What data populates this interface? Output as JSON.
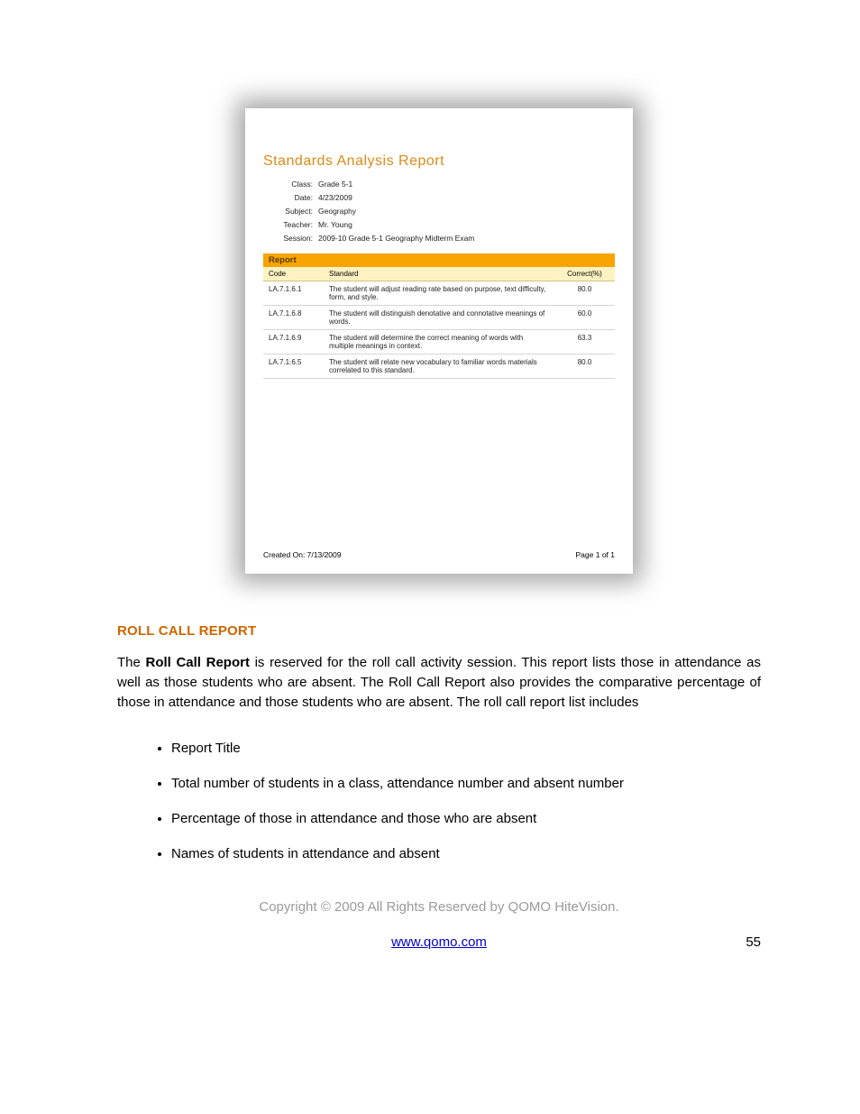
{
  "screenshot": {
    "title": "Standards  Analysis  Report",
    "meta": {
      "class_label": "Class:",
      "class_value": "Grade 5-1",
      "date_label": "Date:",
      "date_value": "4/23/2009",
      "subject_label": "Subject:",
      "subject_value": "Geography",
      "teacher_label": "Teacher:",
      "teacher_value": "Mr. Young",
      "session_label": "Session:",
      "session_value": "2009-10 Grade 5-1 Geography Midterm Exam"
    },
    "report_header": "Report",
    "columns": {
      "code": "Code",
      "standard": "Standard",
      "correct": "Correct(%)"
    },
    "rows": [
      {
        "code": "LA.7.1.6.1",
        "standard": "The student will adjust reading rate based on purpose, text difficulty, form, and style.",
        "pct": "80.0"
      },
      {
        "code": "LA.7.1.6.8",
        "standard": "The student will distinguish denotative and connotative meanings of words.",
        "pct": "60.0"
      },
      {
        "code": "LA.7.1.6.9",
        "standard": "The student will determine the correct meaning of words with multiple meanings in context.",
        "pct": "63.3"
      },
      {
        "code": "LA.7.1.6.5",
        "standard": "The student will relate new vocabulary to familiar words materials correlated to this standard.",
        "pct": "80.0"
      }
    ],
    "footer": {
      "created": "Created On: 7/13/2009",
      "page": "Page 1 of 1"
    }
  },
  "section_heading": "ROLL CALL REPORT",
  "body_intro_prefix": "The ",
  "body_intro_bold": "Roll Call Report",
  "body_intro_rest": " is reserved for the roll call activity session. This report lists those in attendance as well as those students who are absent. The Roll Call Report also provides the comparative percentage of those in attendance and those students who are absent. The roll call report list includes",
  "bullets": [
    "Report Title",
    "Total number of students in a class, attendance number and absent number",
    "Percentage of those in attendance and those who are absent",
    "Names of students in attendance and absent"
  ],
  "copyright": "Copyright © 2009 All Rights Reserved by QOMO HiteVision.",
  "footer_link_text": "www.qomo.com",
  "page_number": "55"
}
